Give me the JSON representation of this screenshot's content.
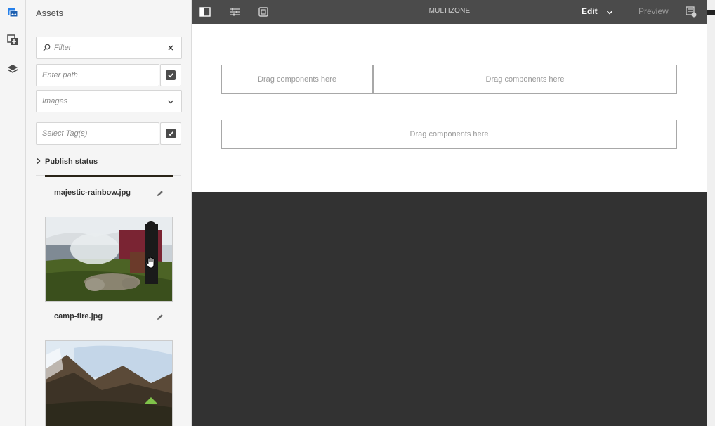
{
  "rail": {
    "items": [
      "assets-icon",
      "components-icon",
      "content-tree-icon"
    ]
  },
  "panel": {
    "title": "Assets",
    "filter_placeholder": "Filter",
    "path_placeholder": "Enter path",
    "type_selected": "Images",
    "tags_placeholder": "Select Tag(s)",
    "publish_status_label": "Publish status",
    "assets": [
      {
        "name": "majestic-rainbow.jpg"
      },
      {
        "name": "camp-fire.jpg"
      }
    ]
  },
  "toolbar": {
    "title": "MULTIZONE",
    "mode_label": "Edit",
    "preview_label": "Preview"
  },
  "canvas": {
    "dropzones": [
      {
        "label": "Drag components here"
      },
      {
        "label": "Drag components here"
      },
      {
        "label": "Drag components here"
      }
    ]
  },
  "colors": {
    "toolbar_bg": "#4b4b4b",
    "rail_accent": "#2680eb",
    "dark_canvas": "#323232"
  }
}
